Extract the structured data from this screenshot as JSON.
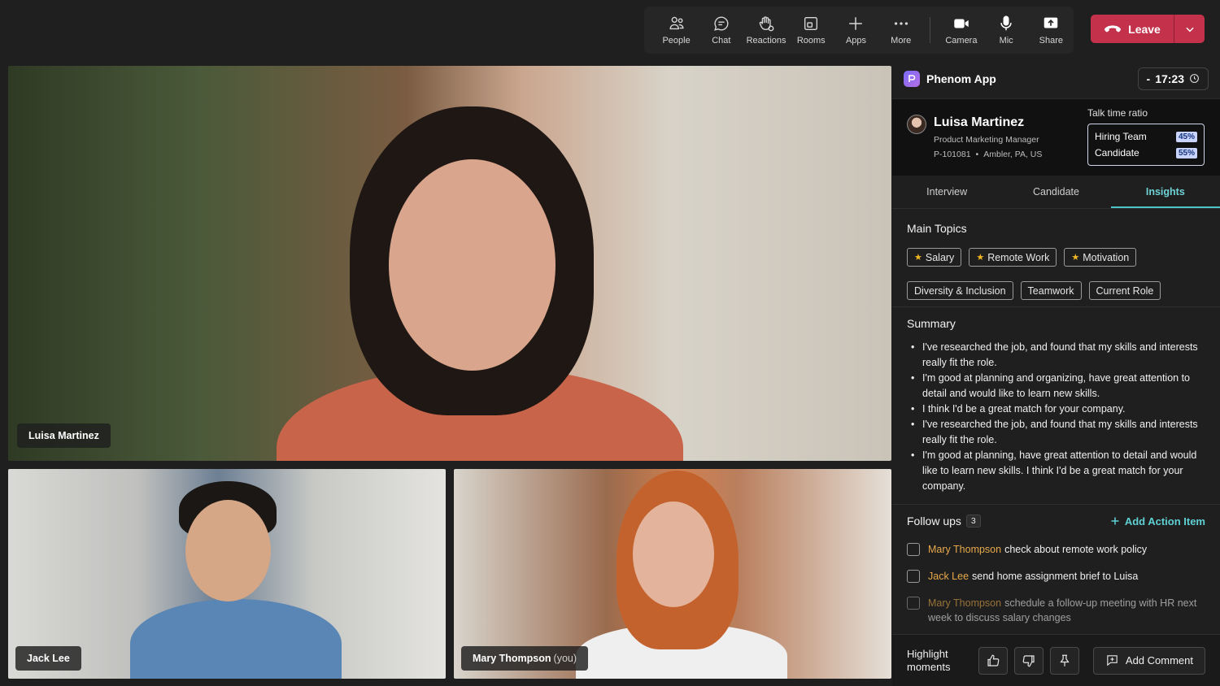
{
  "toolbar": {
    "items": [
      {
        "label": "People",
        "icon": "people-icon"
      },
      {
        "label": "Chat",
        "icon": "chat-icon"
      },
      {
        "label": "Reactions",
        "icon": "reactions-icon"
      },
      {
        "label": "Rooms",
        "icon": "rooms-icon"
      },
      {
        "label": "Apps",
        "icon": "plus-icon"
      },
      {
        "label": "More",
        "icon": "more-icon"
      }
    ],
    "media": [
      {
        "label": "Camera",
        "icon": "camera-icon"
      },
      {
        "label": "Mic",
        "icon": "mic-icon"
      },
      {
        "label": "Share",
        "icon": "share-icon"
      }
    ],
    "leave_label": "Leave",
    "leave_color": "#c4314b"
  },
  "participants": {
    "main": "Luisa Martinez",
    "jack": "Jack Lee",
    "mary": "Mary Thompson",
    "you": "(you)"
  },
  "panel": {
    "app_title": "Phenom App",
    "timer_prefix": "-",
    "timer": "17:23",
    "candidate": {
      "name": "Luisa Martinez",
      "role": "Product Marketing Manager",
      "id": "P-101081",
      "location": "Ambler, PA, US"
    },
    "talk_time": {
      "label": "Talk time ratio",
      "rows": [
        {
          "label": "Hiring Team",
          "pct": "45%"
        },
        {
          "label": "Candidate",
          "pct": "55%"
        }
      ]
    },
    "tabs": [
      "Interview",
      "Candidate",
      "Insights"
    ],
    "active_tab": "Insights",
    "accent": "#4cc4c7",
    "main_topics": {
      "title": "Main Topics",
      "starred": [
        "Salary",
        "Remote Work",
        "Motivation"
      ],
      "others": [
        "Diversity & Inclusion",
        "Teamwork",
        "Current Role"
      ]
    },
    "summary": {
      "title": "Summary",
      "bullets": [
        "I've researched the job, and found that my skills and interests really fit the role.",
        "I'm good at planning and organizing, have great attention to detail and would like to learn new skills.",
        "I think I'd be a great match for your company.",
        "I've researched the job, and found that my skills and interests really fit the role.",
        "I'm good at planning, have great attention to detail and would like to learn new skills. I think I'd be a great match for your company."
      ]
    },
    "follow_ups": {
      "title": "Follow ups",
      "count": "3",
      "add_label": "Add Action Item",
      "items": [
        {
          "who": "Mary Thompson",
          "text": "check about remote work policy"
        },
        {
          "who": "Jack Lee",
          "text": "send home assignment brief to Luisa"
        },
        {
          "who": "Mary Thompson",
          "text": "schedule a follow-up meeting with HR next week to discuss salary changes"
        }
      ]
    },
    "bottom": {
      "highlight_label": "Highlight moments",
      "comment_label": "Add Comment"
    }
  }
}
